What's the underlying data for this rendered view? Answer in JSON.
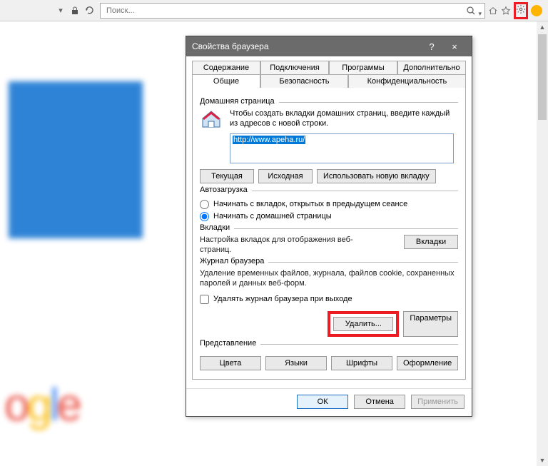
{
  "browser": {
    "search_placeholder": "Поиск...",
    "icons": {
      "lock": "lock",
      "refresh": "refresh",
      "search": "search",
      "home": "home",
      "star": "star",
      "gear": "gear",
      "smiley": "smiley",
      "dropdown": "dropdown"
    }
  },
  "bg": {
    "google_fragment": "ogle"
  },
  "dialog": {
    "title": "Свойства браузера",
    "help": "?",
    "close": "×",
    "tabs_row1": {
      "content": "Содержание",
      "connections": "Подключения",
      "programs": "Программы",
      "advanced": "Дополнительно"
    },
    "tabs_row2": {
      "general": "Общие",
      "security": "Безопасность",
      "privacy": "Конфиденциальность"
    },
    "home": {
      "title": "Домашняя страница",
      "desc": "Чтобы создать вкладки домашних страниц, введите каждый из адресов с новой строки.",
      "url": "http://www.apeha.ru/",
      "btn_current": "Текущая",
      "btn_default": "Исходная",
      "btn_newtab": "Использовать новую вкладку"
    },
    "startup": {
      "title": "Автозагрузка",
      "opt_last": "Начинать с вкладок, открытых в предыдущем сеансе",
      "opt_home": "Начинать с домашней страницы"
    },
    "tabs_section": {
      "title": "Вкладки",
      "desc": "Настройка вкладок для отображения веб-страниц.",
      "btn": "Вкладки"
    },
    "history": {
      "title": "Журнал браузера",
      "desc": "Удаление временных файлов, журнала, файлов cookie, сохраненных паролей и данных веб-форм.",
      "chk": "Удалять журнал браузера при выходе",
      "btn_delete": "Удалить...",
      "btn_params": "Параметры"
    },
    "appearance": {
      "title": "Представление",
      "btn_colors": "Цвета",
      "btn_langs": "Языки",
      "btn_fonts": "Шрифты",
      "btn_format": "Оформление"
    },
    "footer": {
      "ok": "ОК",
      "cancel": "Отмена",
      "apply": "Применить"
    }
  }
}
